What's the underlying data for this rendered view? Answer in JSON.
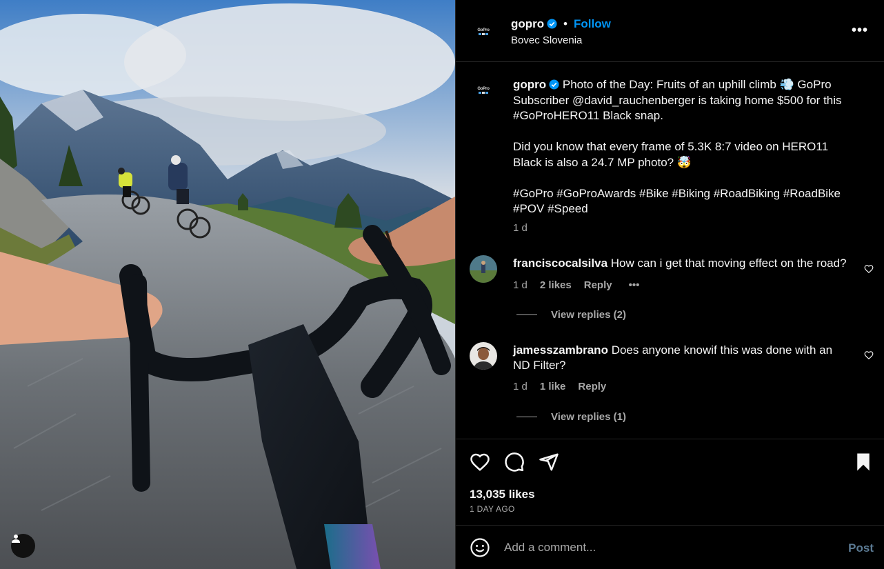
{
  "header": {
    "username": "gopro",
    "dot": "•",
    "follow_label": "Follow",
    "location": "Bovec Slovenia",
    "more_icon": "more-horizontal-icon"
  },
  "caption": {
    "username": "gopro",
    "line1": "Photo of the Day: Fruits of an uphill climb 💨 GoPro",
    "line2": "Subscriber @david_rauchenberger is taking home $500 for this",
    "line3": "#GoProHERO11 Black snap.",
    "line4": "Did you know that every frame of 5.3K 8:7 video on HERO11",
    "line5": "Black is also a 24.7 MP photo? 🤯",
    "line6": "#GoPro #GoProAwards #Bike #Biking #RoadBiking #RoadBike",
    "line7": "#POV #Speed",
    "time": "1 d"
  },
  "comments": [
    {
      "username": "franciscocalsilva",
      "text": "How can i get that moving effect on the road?",
      "time": "1 d",
      "likes": "2 likes",
      "reply": "Reply",
      "more": "•••",
      "view_replies": "View replies (2)"
    },
    {
      "username": "jamesszambrano",
      "text_line1": "Does anyone knowif this was done with an",
      "text_line2": "ND Filter?",
      "time": "1 d",
      "likes": "1 like",
      "reply": "Reply",
      "view_replies": "View replies (1)"
    }
  ],
  "actions": {
    "likes_count": "13,035 likes",
    "post_date": "1 DAY AGO"
  },
  "add_comment": {
    "placeholder": "Add a comment...",
    "post_label": "Post"
  },
  "logo_text": "GoPro",
  "colors": {
    "background": "#000000",
    "accent": "#0095f6",
    "muted_text": "#a8a8a8",
    "divider": "#262626",
    "post_disabled": "#5b7a93"
  }
}
